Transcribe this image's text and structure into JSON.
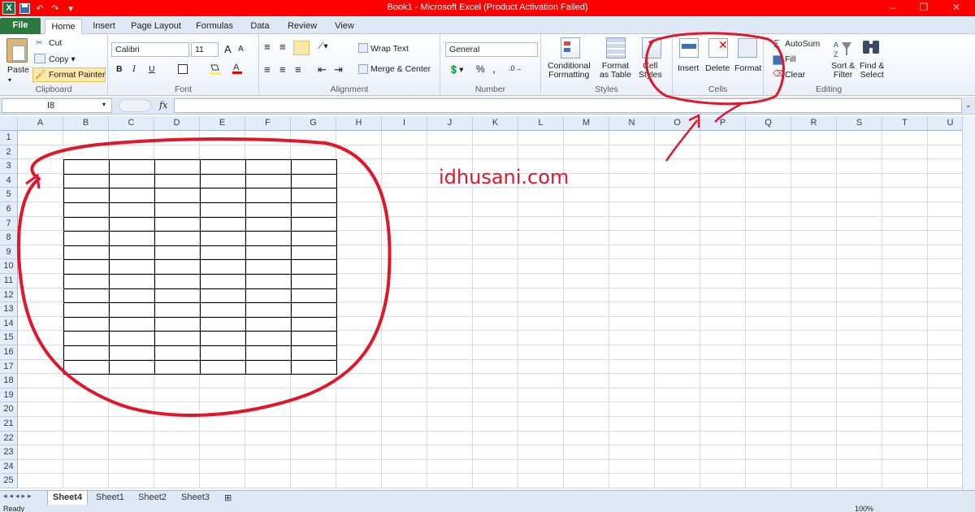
{
  "titlebar": {
    "title": "Book1  -  Microsoft Excel (Product Activation Failed)",
    "qat": [
      "X",
      "💾",
      "↶",
      "↷",
      "▾"
    ],
    "window_buttons": [
      "–",
      "❐",
      "✕"
    ]
  },
  "tabs": [
    "File",
    "Home",
    "Insert",
    "Page Layout",
    "Formulas",
    "Data",
    "Review",
    "View"
  ],
  "ribbon": {
    "clipboard": {
      "paste": "Paste",
      "cut": "Cut",
      "copy": "Copy ▾",
      "format_painter": "Format Painter",
      "label": "Clipboard"
    },
    "font": {
      "name": "Calibri",
      "size": "11",
      "grow": "A",
      "shrink": "A",
      "bold": "B",
      "italic": "I",
      "underline": "U",
      "label": "Font"
    },
    "alignment": {
      "wrap": "Wrap Text",
      "merge": "Merge & Center",
      "label": "Alignment"
    },
    "number": {
      "format": "General",
      "percent": "%",
      "comma": ",",
      "label": "Number"
    },
    "styles": {
      "conditional": "Conditional\nFormatting",
      "table": "Format\nas Table",
      "cell": "Cell\nStyles",
      "label": "Styles"
    },
    "cells": {
      "insert": "Insert",
      "delete": "Delete",
      "format": "Format",
      "label": "Cells"
    },
    "editing": {
      "autosum": "AutoSum",
      "fill": "Fill",
      "clear": "Clear",
      "sort": "Sort &\nFilter",
      "find": "Find &\nSelect",
      "label": "Editing"
    }
  },
  "formula_bar": {
    "name_box": "I8",
    "fx": "fx",
    "formula": ""
  },
  "columns": [
    "A",
    "B",
    "C",
    "D",
    "E",
    "F",
    "G",
    "H",
    "I",
    "J",
    "K",
    "L",
    "M",
    "N",
    "O",
    "P",
    "Q",
    "R",
    "S",
    "T",
    "U"
  ],
  "rows": [
    "1",
    "2",
    "3",
    "4",
    "5",
    "6",
    "7",
    "8",
    "9",
    "10",
    "11",
    "12",
    "13",
    "14",
    "15",
    "16",
    "17",
    "18",
    "19",
    "20",
    "21",
    "22",
    "23",
    "24",
    "25"
  ],
  "watermark": "idhusani.com",
  "sheet_tabs": [
    "Sheet4",
    "Sheet1",
    "Sheet2",
    "Sheet3"
  ],
  "status": {
    "ready": "Ready",
    "zoom": "100%"
  },
  "colors": {
    "title_bar": "#ff0000",
    "annotation": "#e0162b",
    "file_tab": "#2a7a3e"
  }
}
